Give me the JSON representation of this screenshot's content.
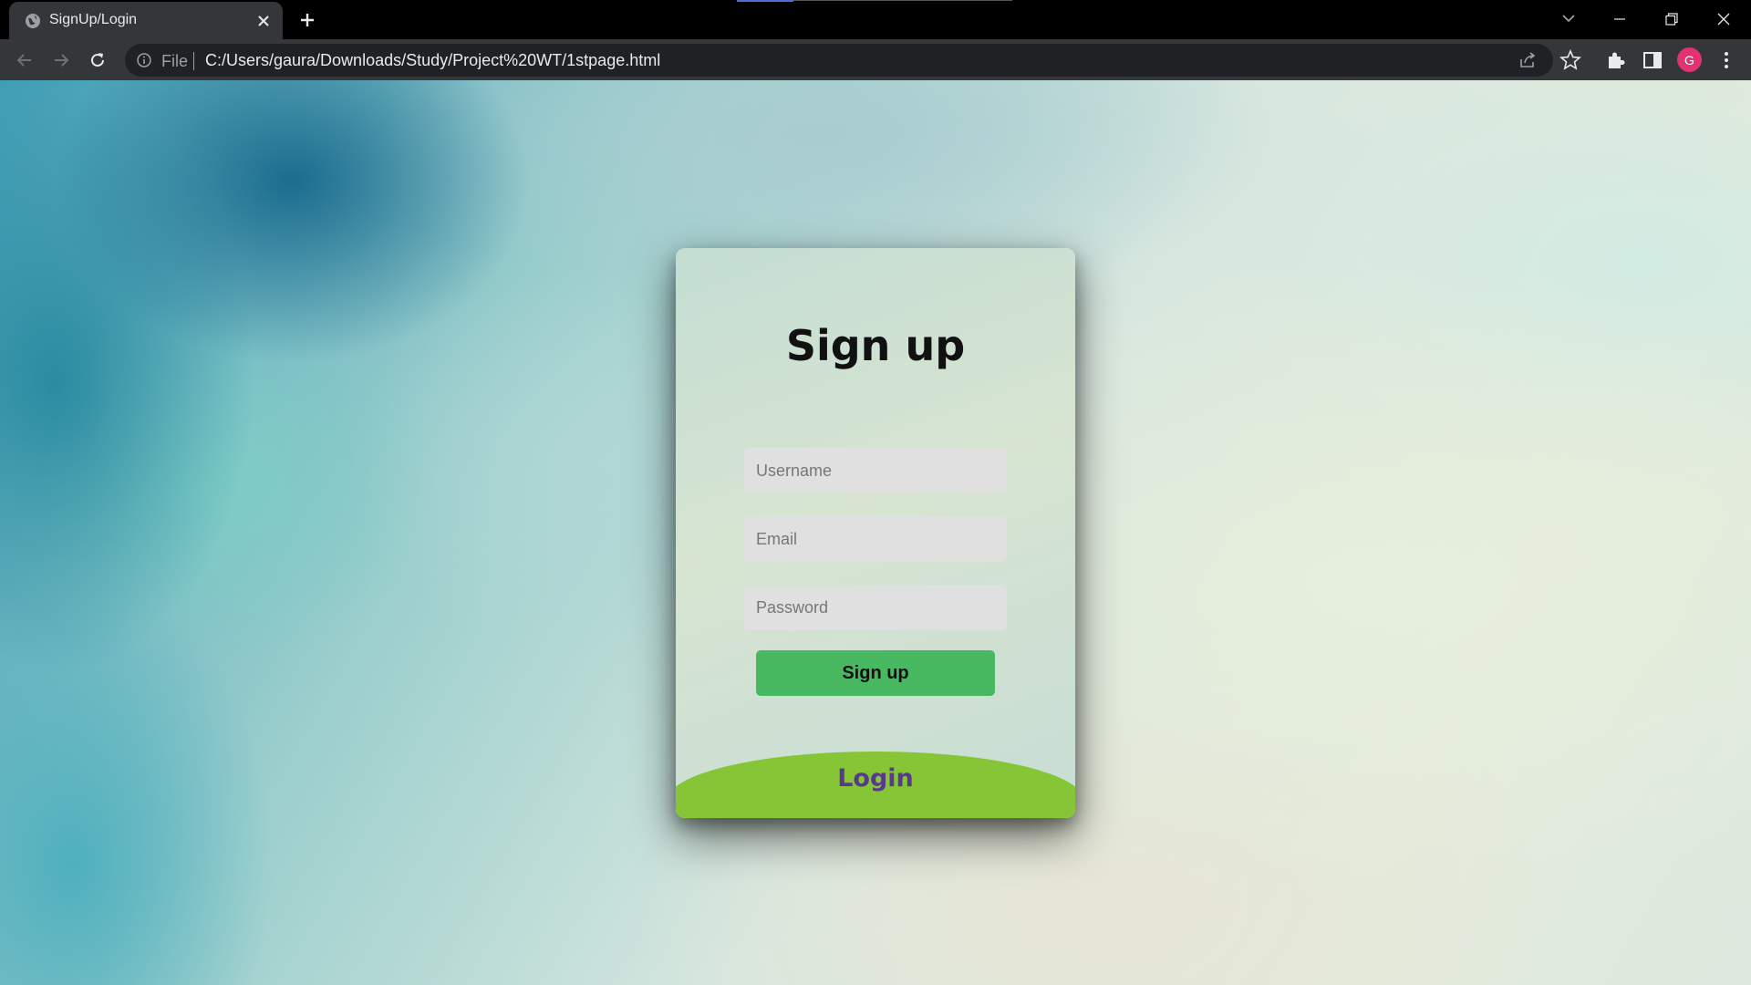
{
  "browser": {
    "tab_title": "SignUp/Login",
    "omnibox": {
      "scheme_label": "File",
      "url": "C:/Users/gaura/Downloads/Study/Project%20WT/1stpage.html"
    },
    "profile_initial": "G",
    "icons": [
      "globe-icon",
      "close-icon",
      "plus-icon",
      "chevron-down-icon",
      "minimize-icon",
      "restore-icon",
      "close-window-icon",
      "back-arrow-icon",
      "forward-arrow-icon",
      "reload-icon",
      "info-icon",
      "share-icon",
      "star-icon",
      "puzzle-icon",
      "side-panel-icon",
      "more-vert-icon"
    ]
  },
  "page": {
    "title": "Sign up",
    "fields": {
      "username_placeholder": "Username",
      "email_placeholder": "Email",
      "password_placeholder": "Password"
    },
    "signup_button": "Sign up",
    "login_label": "Login"
  },
  "colors": {
    "signup_button": "#48b961",
    "login_area": "#85c536",
    "login_text": "#573b8a",
    "avatar": "#e0336f"
  }
}
